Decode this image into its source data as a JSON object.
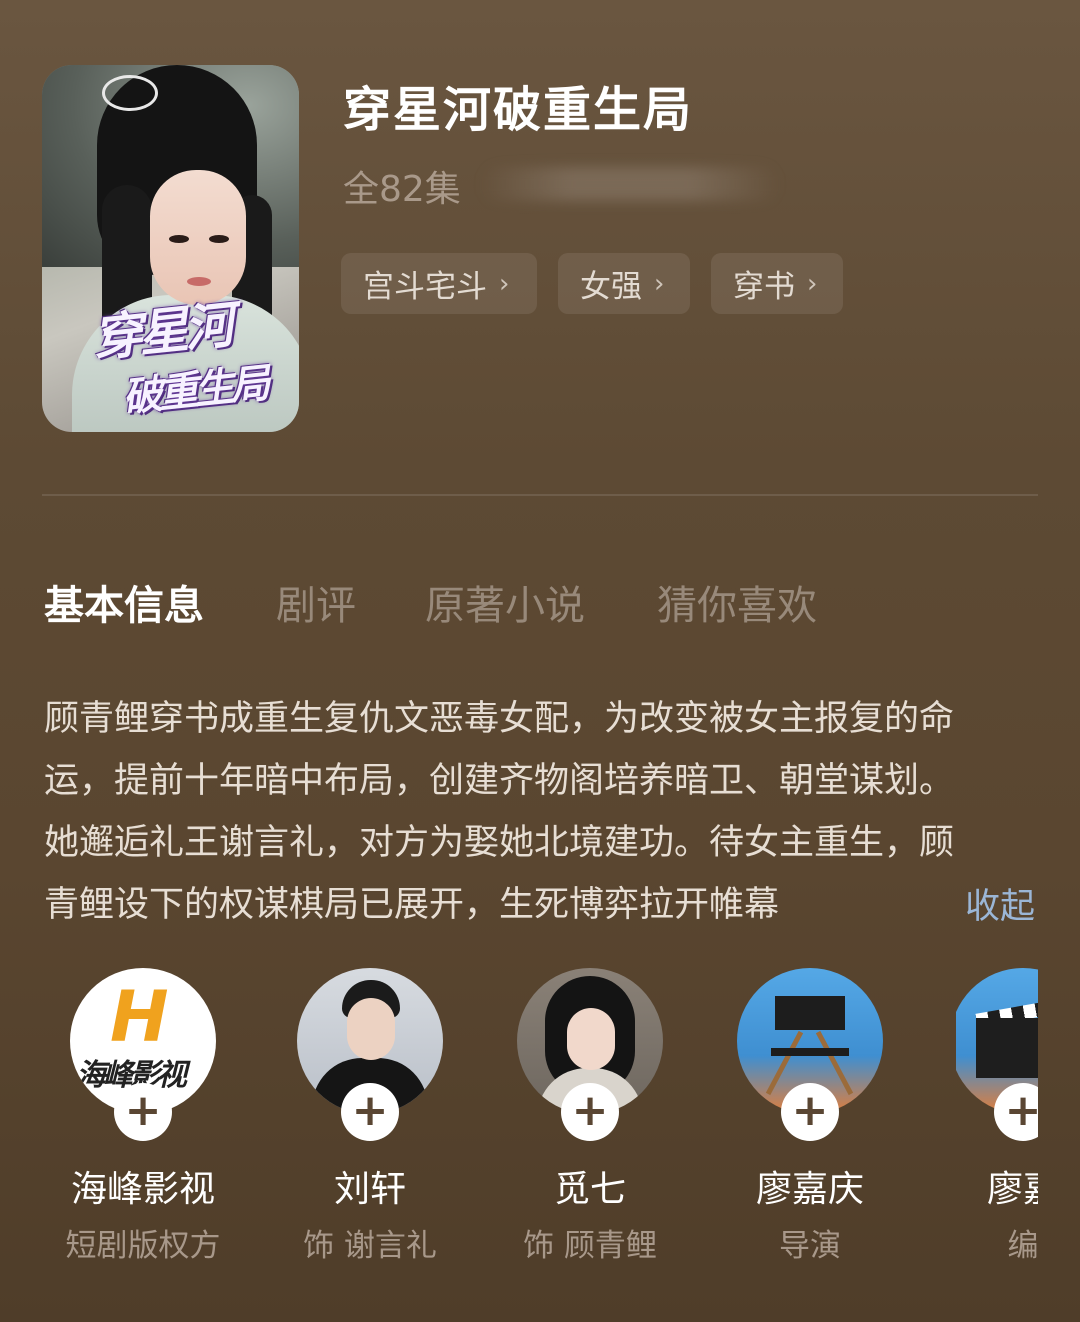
{
  "show": {
    "title": "穿星河破重生局",
    "episodes": "全82集",
    "poster_art_text": [
      "穿星河",
      "破重生局"
    ]
  },
  "tags": [
    {
      "label": "宫斗宅斗",
      "icon": "chevron-right-icon"
    },
    {
      "label": "女强",
      "icon": "chevron-right-icon"
    },
    {
      "label": "穿书",
      "icon": "chevron-right-icon"
    }
  ],
  "tabs": [
    {
      "label": "基本信息",
      "active": true
    },
    {
      "label": "剧评",
      "active": false
    },
    {
      "label": "原著小说",
      "active": false
    },
    {
      "label": "猜你喜欢",
      "active": false
    }
  ],
  "description": {
    "lines": [
      "顾青鲤穿书成重生复仇文恶毒女配，为改变被女主报复的命",
      "运，提前十年暗中布局，创建齐物阁培养暗卫、朝堂谋划。",
      "她邂逅礼王谢言礼，对方为娶她北境建功。待女主重生，顾",
      "青鲤设下的权谋棋局已展开，生死博弈拉开帷幕"
    ],
    "collapse_label": "收起"
  },
  "cast": [
    {
      "name": "海峰影视",
      "role": "短剧版权方",
      "logo_text": "海峰影视",
      "logo_letter": "H",
      "follow_icon": "plus-icon"
    },
    {
      "name": "刘轩",
      "role": "饰 谢言礼",
      "follow_icon": "plus-icon"
    },
    {
      "name": "觅七",
      "role": "饰 顾青鲤",
      "follow_icon": "plus-icon"
    },
    {
      "name": "廖嘉庆",
      "role": "导演",
      "follow_icon": "plus-icon"
    },
    {
      "name": "廖嘉",
      "role": "编",
      "follow_icon": "plus-icon"
    }
  ],
  "colors": {
    "background": "#5d4a34",
    "accent_link": "#9bb6d6",
    "muted_text": "#a8988a"
  }
}
